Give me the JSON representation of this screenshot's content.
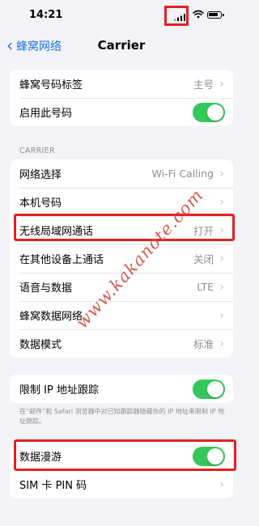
{
  "status_bar": {
    "time": "14:21"
  },
  "nav": {
    "back_label": "蜂窝网络",
    "title": "Carrier"
  },
  "group1": [
    {
      "label": "蜂窝号码标签",
      "value": "主号"
    },
    {
      "label": "启用此号码",
      "toggle": true
    }
  ],
  "carrier_section": {
    "header": "CARRIER",
    "rows": [
      {
        "label": "网络选择",
        "value": "Wi-Fi Calling"
      },
      {
        "label": "本机号码",
        "value": ""
      },
      {
        "label": "无线局域网通话",
        "value": "打开"
      },
      {
        "label": "在其他设备上通话",
        "value": "关闭"
      },
      {
        "label": "语音与数据",
        "value": "LTE"
      },
      {
        "label": "蜂窝数据网络",
        "value": ""
      },
      {
        "label": "数据模式",
        "value": "标准"
      }
    ]
  },
  "ip_tracking": {
    "label": "限制 IP 地址跟踪",
    "toggle": true,
    "footnote": "在“邮件”和 Safari 浏览器中对已知跟踪器隐藏你的 IP 地址来限制 IP 地址跟踪。"
  },
  "bottom_group": [
    {
      "label": "数据漫游",
      "toggle": true
    },
    {
      "label": "SIM 卡 PIN 码",
      "value": ""
    }
  ],
  "watermark": "www.kakanote.com",
  "colors": {
    "highlight": "#e02222",
    "toggle_on": "#34c759",
    "link": "#1a73e8"
  }
}
